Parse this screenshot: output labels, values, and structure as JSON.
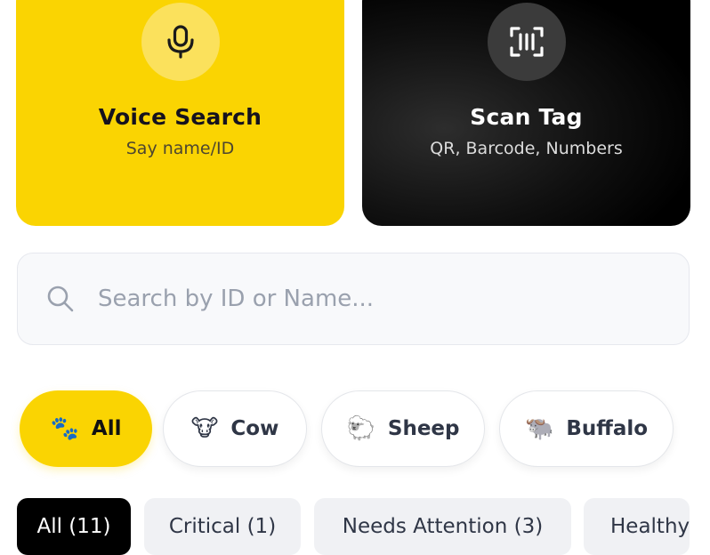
{
  "quick_actions": {
    "voice": {
      "title": "Voice Search",
      "subtitle": "Say name/ID",
      "icon": "microphone-icon",
      "bg": "#fad402"
    },
    "scan": {
      "title": "Scan Tag",
      "subtitle": "QR, Barcode, Numbers",
      "icon": "scan-tag-icon",
      "bg": "#000000"
    }
  },
  "search": {
    "placeholder": "Search by ID or Name...",
    "value": "",
    "icon": "search-icon"
  },
  "species_filters": [
    {
      "emoji": "🐾",
      "label": "All",
      "active": true
    },
    {
      "emoji": "🐮",
      "label": "Cow",
      "active": false
    },
    {
      "emoji": "🐑",
      "label": "Sheep",
      "active": false
    },
    {
      "emoji": "🐃",
      "label": "Buffalo",
      "active": false
    }
  ],
  "status_filters": [
    {
      "label": "All (11)",
      "active": true
    },
    {
      "label": "Critical (1)",
      "active": false
    },
    {
      "label": "Needs Attention (3)",
      "active": false
    },
    {
      "label": "Healthy",
      "active": false
    }
  ],
  "colors": {
    "accent": "#fad402",
    "dark": "#000000",
    "text": "#2f3646",
    "placeholder": "#9aa1ae"
  }
}
